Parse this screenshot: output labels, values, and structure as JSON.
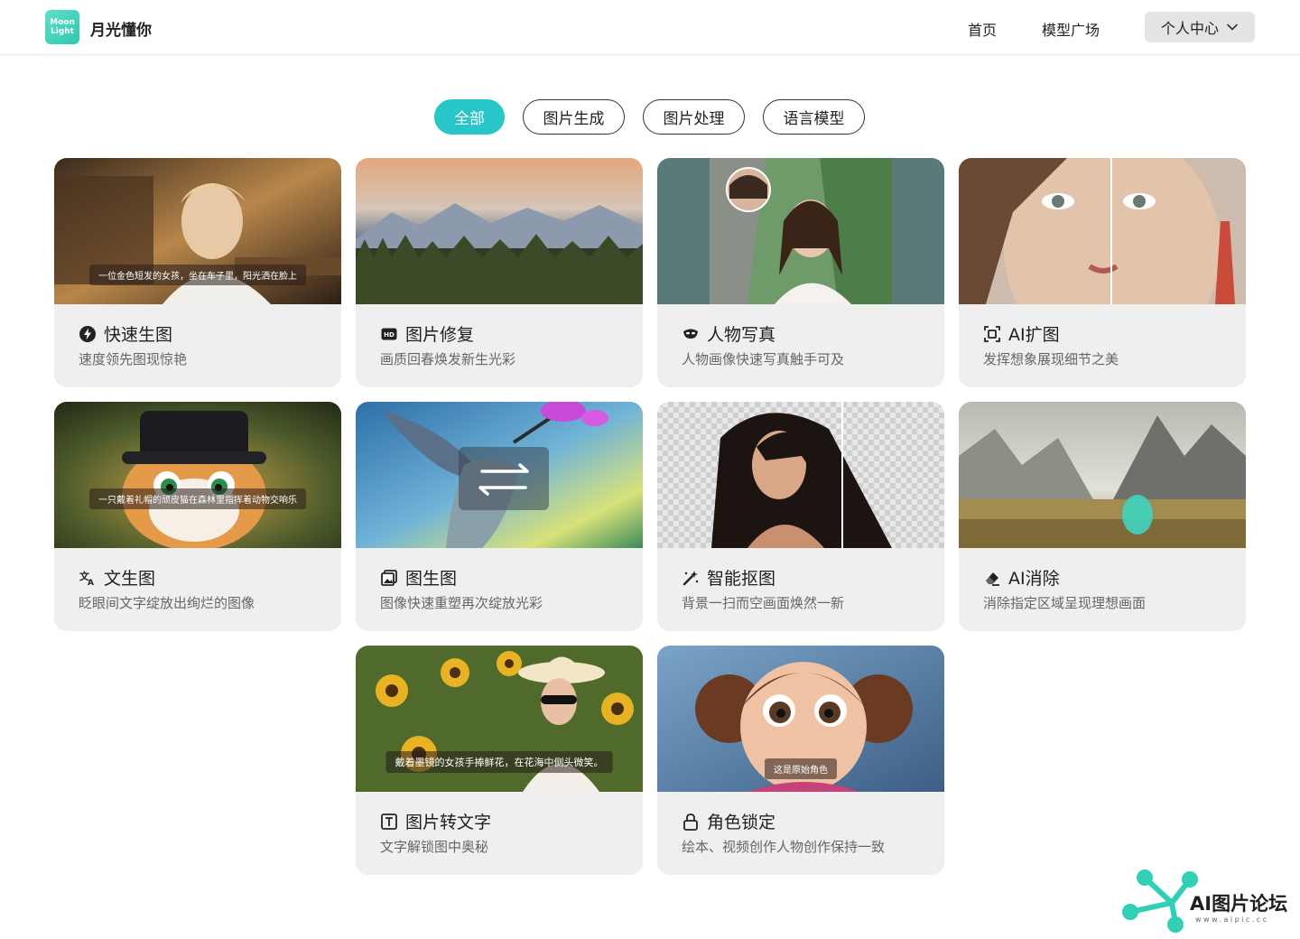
{
  "brand": {
    "logo_line1": "Moon",
    "logo_line2": "Light",
    "name": "月光懂你"
  },
  "nav": {
    "home": "首页",
    "models": "模型广场",
    "user_center": "个人中心"
  },
  "filters": [
    {
      "label": "全部",
      "active": true
    },
    {
      "label": "图片生成",
      "active": false
    },
    {
      "label": "图片处理",
      "active": false
    },
    {
      "label": "语言模型",
      "active": false
    }
  ],
  "cards": [
    {
      "title": "快速生图",
      "desc": "速度领先图现惊艳",
      "caption": "一位金色短发的女孩，坐在车子里，阳光洒在脸上",
      "icon": "lightning-icon"
    },
    {
      "title": "图片修复",
      "desc": "画质回春焕发新生光彩",
      "caption": "",
      "icon": "hd-icon"
    },
    {
      "title": "人物写真",
      "desc": "人物画像快速写真触手可及",
      "caption": "",
      "icon": "mask-icon"
    },
    {
      "title": "AI扩图",
      "desc": "发挥想象展现细节之美",
      "caption": "",
      "icon": "expand-frame-icon"
    },
    {
      "title": "文生图",
      "desc": "眨眼间文字绽放出绚烂的图像",
      "caption": "一只戴着礼帽的顽皮猫在森林里指挥着动物交响乐",
      "icon": "translate-icon"
    },
    {
      "title": "图生图",
      "desc": "图像快速重塑再次绽放光彩",
      "caption": "",
      "icon": "image-stack-icon"
    },
    {
      "title": "智能抠图",
      "desc": "背景一扫而空画面焕然一新",
      "caption": "",
      "icon": "magic-wand-icon"
    },
    {
      "title": "AI消除",
      "desc": "消除指定区域呈现理想画面",
      "caption": "",
      "icon": "eraser-icon"
    },
    {
      "title": "图片转文字",
      "desc": "文字解锁图中奥秘",
      "caption": "戴着墨镜的女孩手捧鲜花，在花海中侧头微笑。",
      "icon": "text-box-icon"
    },
    {
      "title": "角色锁定",
      "desc": "绘本、视频创作人物创作保持一致",
      "caption": "这是原始角色",
      "icon": "lock-icon"
    }
  ],
  "watermark": {
    "text": "AI图片论坛",
    "url": "www.aipic.cc"
  },
  "colors": {
    "accent": "#26c6c9",
    "card_bg": "#efefef",
    "logo": "#3fd0b8"
  }
}
